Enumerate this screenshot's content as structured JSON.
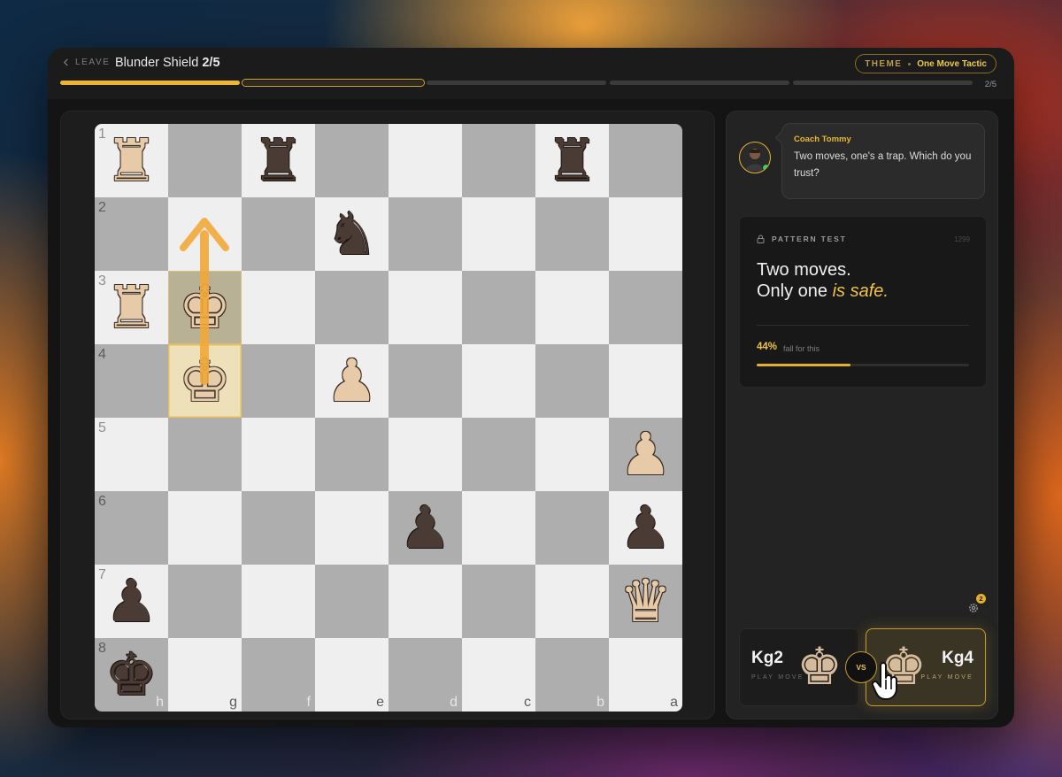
{
  "header": {
    "back_label": "LEAVE",
    "title": "Blunder Shield",
    "progress": "2/5",
    "theme_label": "THEME",
    "theme_value": "One Move Tactic",
    "counter": "2/5",
    "segments": [
      "done",
      "current",
      "todo",
      "todo",
      "todo"
    ]
  },
  "board": {
    "ranks": [
      "1",
      "2",
      "3",
      "4",
      "5",
      "6",
      "7",
      "8"
    ],
    "files": [
      "h",
      "g",
      "f",
      "e",
      "d",
      "c",
      "b",
      "a"
    ],
    "pieces": {
      "0": {
        "0": "wR",
        "2": "bR",
        "6": "bR"
      },
      "1": {
        "3": "bN"
      },
      "2": {
        "0": "wR",
        "1": "wK"
      },
      "3": {
        "1": "wK",
        "3": "wP"
      },
      "4": {
        "7": "wP"
      },
      "5": {
        "4": "bP",
        "7": "bP"
      },
      "6": {
        "0": "bP",
        "7": "wQ"
      },
      "7": {
        "0": "bK"
      }
    }
  },
  "coach": {
    "name": "Coach Tommy",
    "message": "Two moves, one's a trap. Which do you trust?"
  },
  "pattern": {
    "label": "PATTERN TEST",
    "number": "1299",
    "line1": "Two moves.",
    "line2_prefix": "Only one ",
    "line2_em": "is safe.",
    "percent": "44%",
    "percent_value": 44,
    "fall_text": "fall for this"
  },
  "settings": {
    "badge": "2"
  },
  "choices": {
    "left": {
      "move": "Kg2",
      "sub": "PLAY MOVE"
    },
    "right": {
      "move": "Kg4",
      "sub": "PLAY MOVE"
    },
    "vs": "VS"
  },
  "colors": {
    "accent": "#f0b52e",
    "online": "#2fd06a"
  }
}
